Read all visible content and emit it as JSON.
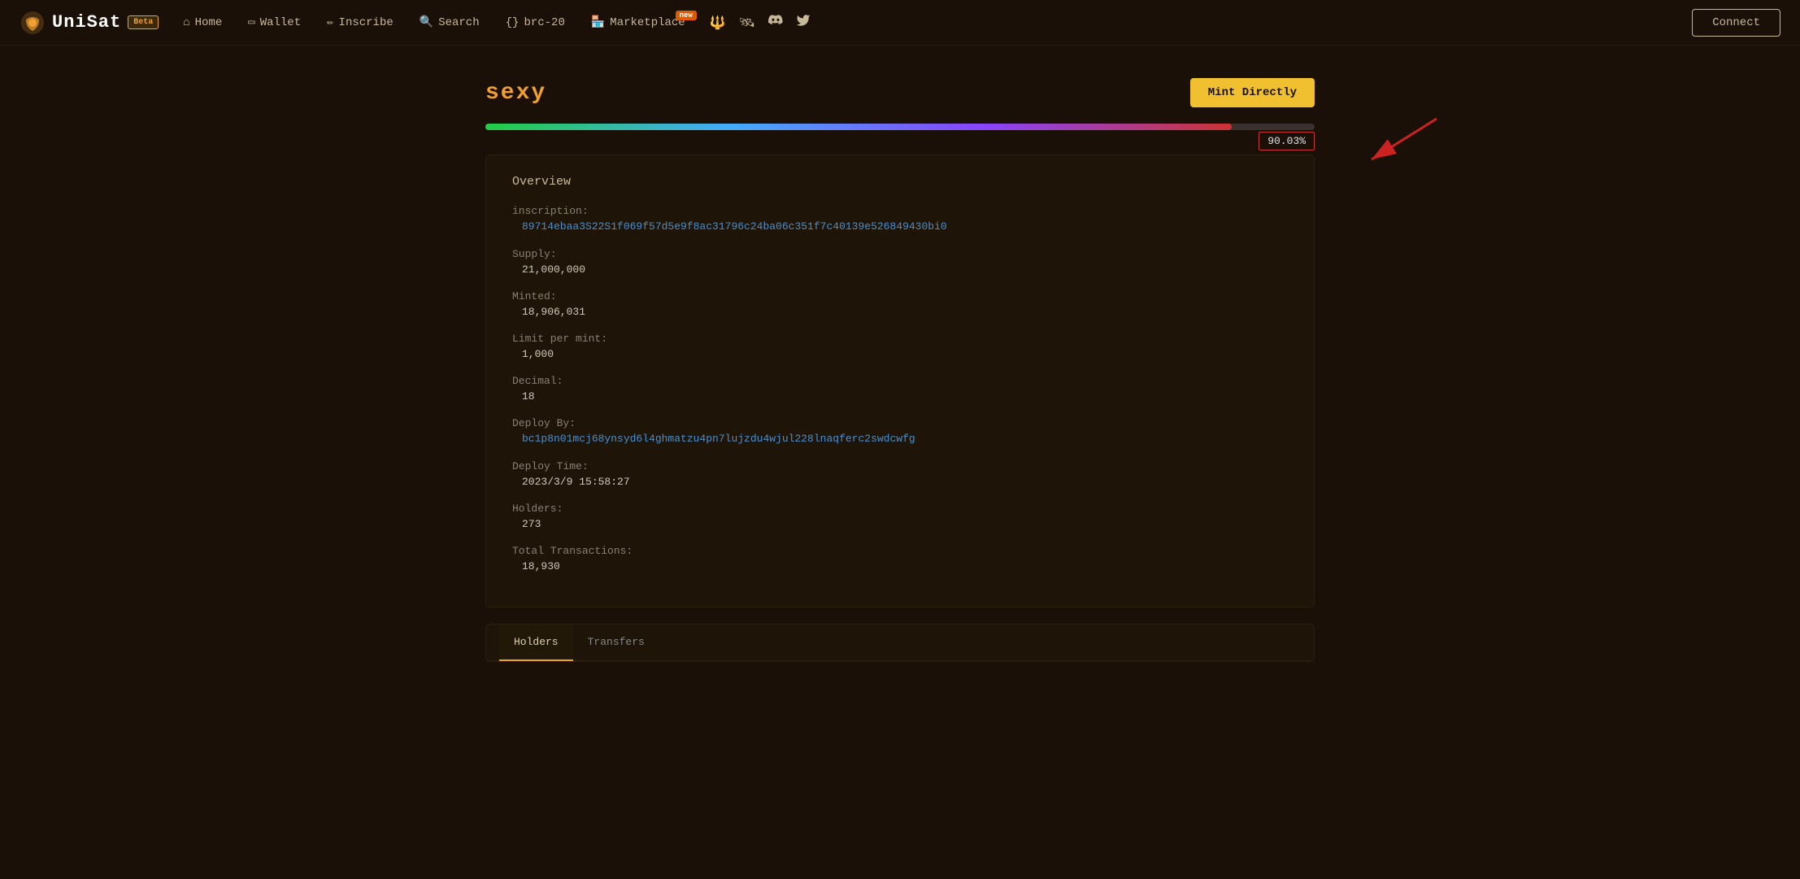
{
  "app": {
    "logo_text": "UniSat",
    "beta_label": "Beta",
    "connect_label": "Connect"
  },
  "nav": {
    "links": [
      {
        "id": "home",
        "icon": "⌂",
        "label": "Home"
      },
      {
        "id": "wallet",
        "icon": "▭",
        "label": "Wallet"
      },
      {
        "id": "inscribe",
        "icon": "✏",
        "label": "Inscribe"
      },
      {
        "id": "search",
        "icon": "🔍",
        "label": "Search"
      },
      {
        "id": "brc20",
        "icon": "{}",
        "label": "brc-20"
      },
      {
        "id": "marketplace",
        "icon": "🏪",
        "label": "Marketplace",
        "badge": "new"
      }
    ]
  },
  "token": {
    "name": "sexy",
    "mint_directly_label": "Mint Directly",
    "progress_percent": "90.03%",
    "progress_value": 90.03,
    "overview_title": "Overview",
    "inscription_label": "inscription:",
    "inscription_value": "89714ebaa3S22S1f069f57d5e9f8ac31796c24ba06c351f7c40139e526849430bi0",
    "supply_label": "Supply:",
    "supply_value": "21,000,000",
    "minted_label": "Minted:",
    "minted_value": "18,906,031",
    "limit_label": "Limit per mint:",
    "limit_value": "1,000",
    "decimal_label": "Decimal:",
    "decimal_value": "18",
    "deploy_by_label": "Deploy By:",
    "deploy_by_value": "bc1p8n01mcj68ynsyd6l4ghmatzu4pn7lujzdu4wjul228lnaqferc2swdcwfg",
    "deploy_time_label": "Deploy Time:",
    "deploy_time_value": "2023/3/9 15:58:27",
    "holders_label": "Holders:",
    "holders_value": "273",
    "total_tx_label": "Total Transactions:",
    "total_tx_value": "18,930"
  },
  "tabs": [
    {
      "id": "holders",
      "label": "Holders",
      "active": true
    },
    {
      "id": "transfers",
      "label": "Transfers",
      "active": false
    }
  ]
}
